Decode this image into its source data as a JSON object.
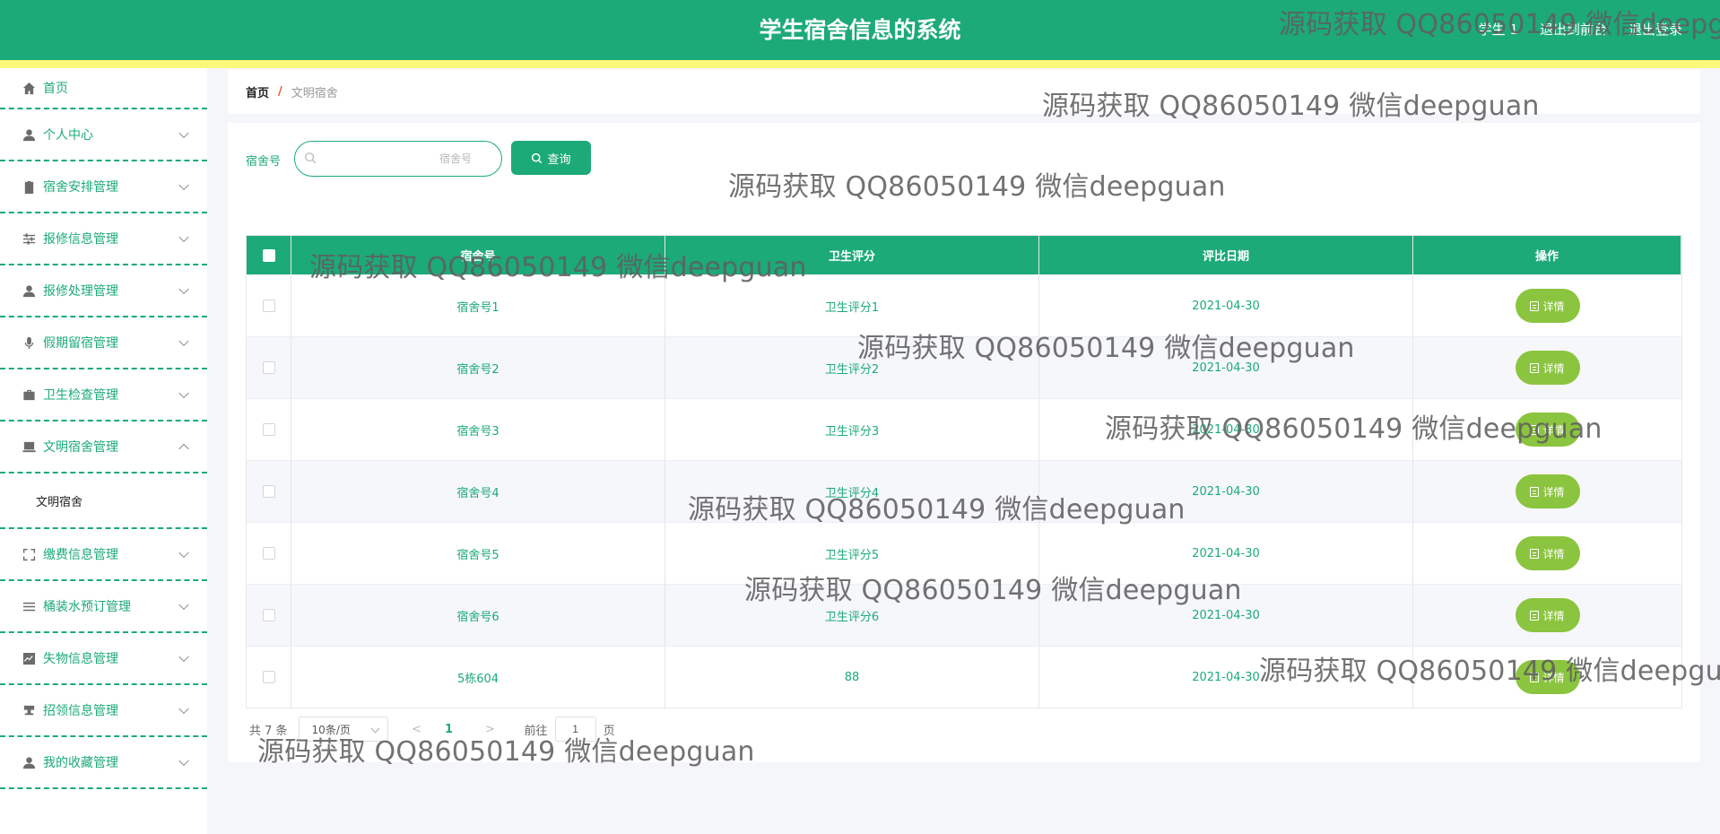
{
  "header": {
    "title": "学生宿舍信息的系统",
    "links": [
      "学生 1",
      "退出到前台",
      "退出登录"
    ],
    "bg_color": "#1caa78",
    "stripe_color": "#fbf97a"
  },
  "sidebar": {
    "items": [
      {
        "label": "首页",
        "icon": "home-icon"
      },
      {
        "label": "个人中心",
        "icon": "user-icon"
      },
      {
        "label": "宿舍安排管理",
        "icon": "clipboard-icon"
      },
      {
        "label": "报修信息管理",
        "icon": "sliders-icon"
      },
      {
        "label": "报修处理管理",
        "icon": "user-icon"
      },
      {
        "label": "假期留宿管理",
        "icon": "microphone-icon"
      },
      {
        "label": "卫生检查管理",
        "icon": "briefcase-icon"
      },
      {
        "label": "文明宿舍管理",
        "icon": "laptop-icon"
      },
      {
        "label": "缴费信息管理",
        "icon": "fullscreen-icon"
      },
      {
        "label": "桶装水预订管理",
        "icon": "list-icon"
      },
      {
        "label": "失物信息管理",
        "icon": "chart-icon"
      },
      {
        "label": "招领信息管理",
        "icon": "stamp-icon"
      },
      {
        "label": "我的收藏管理",
        "icon": "user-icon"
      }
    ],
    "submenu_label": "文明宿舍"
  },
  "breadcrumb": {
    "home": "首页",
    "sep": "/",
    "current": "文明宿舍"
  },
  "search": {
    "label": "宿舍号",
    "placeholder": "宿舍号",
    "button": "查询"
  },
  "table": {
    "headers": [
      "宿舍号",
      "卫生评分",
      "评比日期",
      "操作"
    ],
    "rows": [
      [
        "宿舍号1",
        "卫生评分1",
        "2021-04-30"
      ],
      [
        "宿舍号2",
        "卫生评分2",
        "2021-04-30"
      ],
      [
        "宿舍号3",
        "卫生评分3",
        "2021-04-30"
      ],
      [
        "宿舍号4",
        "卫生评分4",
        "2021-04-30"
      ],
      [
        "宿舍号5",
        "卫生评分5",
        "2021-04-30"
      ],
      [
        "宿舍号6",
        "卫生评分6",
        "2021-04-30"
      ],
      [
        "5栋604",
        "88",
        "2021-04-30"
      ]
    ],
    "action_label": "详情"
  },
  "pagination": {
    "total": "共 7 条",
    "page_size": "10条/页",
    "prev": "<",
    "current": "1",
    "next": ">",
    "goto_label": "前往",
    "goto_value": "1",
    "page_suffix": "页"
  },
  "watermark": "源码获取 QQ86050149 微信deepguan"
}
